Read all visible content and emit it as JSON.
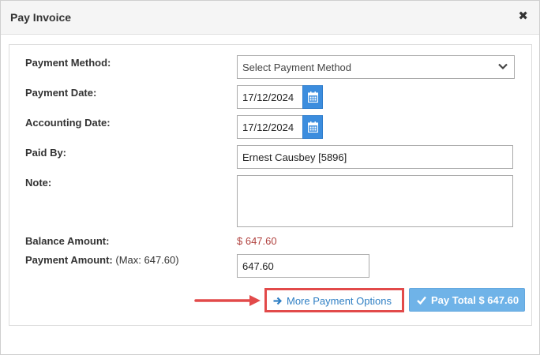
{
  "modal": {
    "title": "Pay Invoice",
    "close_icon": "close-icon"
  },
  "form": {
    "payment_method": {
      "label": "Payment Method:",
      "value": "Select Payment Method"
    },
    "payment_date": {
      "label": "Payment Date:",
      "value": "17/12/2024"
    },
    "accounting_date": {
      "label": "Accounting Date:",
      "value": "17/12/2024"
    },
    "paid_by": {
      "label": "Paid By:",
      "value": "Ernest Causbey [5896]"
    },
    "note": {
      "label": "Note:",
      "value": ""
    },
    "balance_amount": {
      "label": "Balance Amount:",
      "value": "$ 647.60"
    },
    "payment_amount": {
      "label": "Payment Amount:",
      "max_hint": "(Max: 647.60)",
      "value": "647.60"
    }
  },
  "actions": {
    "more_options_label": "More Payment Options",
    "pay_total_label": "Pay Total $ 647.60"
  },
  "colors": {
    "accent": "#3c8dde",
    "pay_button": "#6fb3e8",
    "balance_text": "#b0413e",
    "highlight": "#e24a4a"
  }
}
